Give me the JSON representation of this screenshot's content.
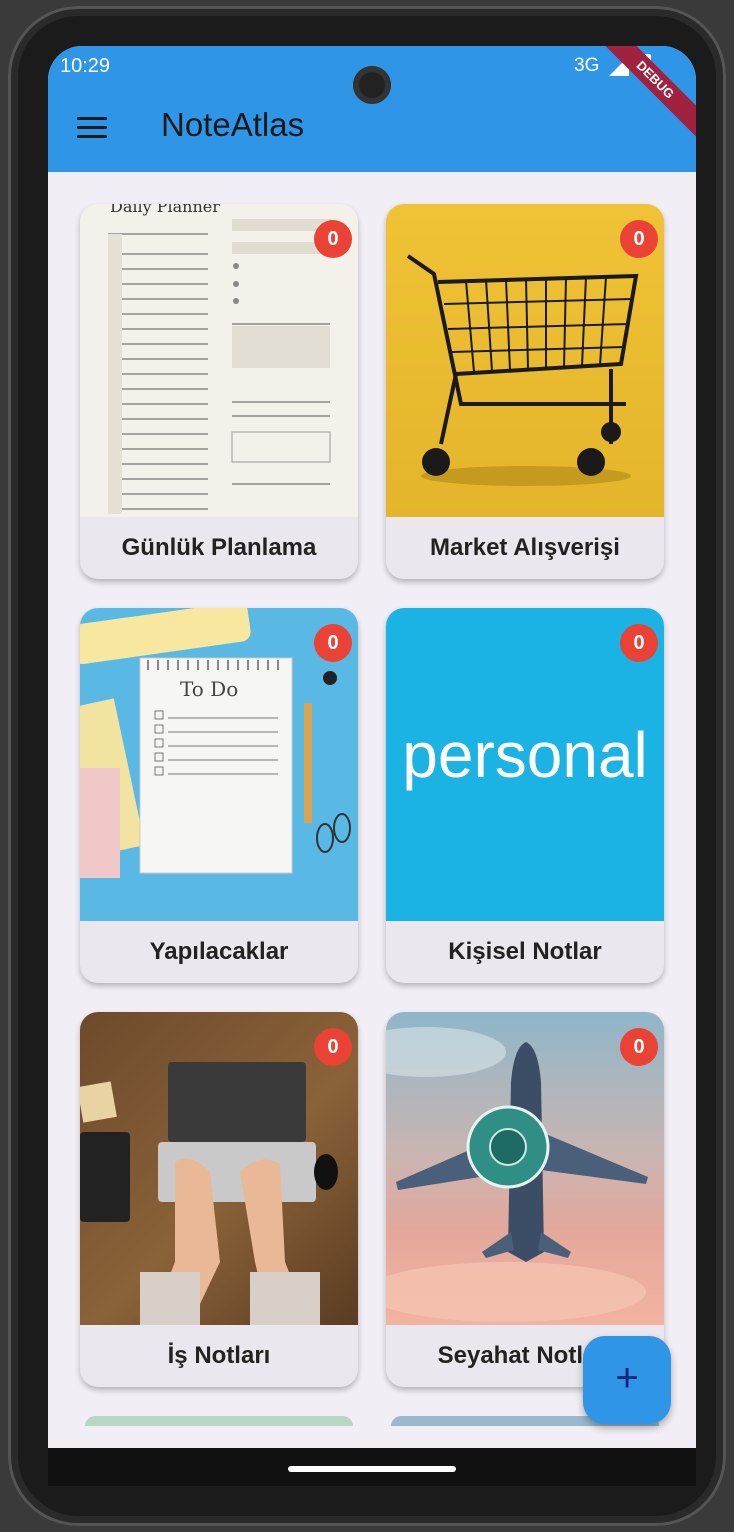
{
  "status_bar": {
    "time": "10:29",
    "network": "3G",
    "debug_banner": "DEBUG"
  },
  "app_bar": {
    "title": "NoteAtlas",
    "menu_icon": "hamburger-menu-icon"
  },
  "categories": [
    {
      "label": "Günlük Planlama",
      "count": "0",
      "image": "daily-planner-image",
      "image_heading": "Daily Planner"
    },
    {
      "label": "Market Alışverişi",
      "count": "0",
      "image": "shopping-cart-image"
    },
    {
      "label": "Yapılacaklar",
      "count": "0",
      "image": "todo-notepad-image",
      "image_heading": "To Do"
    },
    {
      "label": "Kişisel Notlar",
      "count": "0",
      "image": "personal-image",
      "image_text": "personal"
    },
    {
      "label": "İş Notları",
      "count": "0",
      "image": "laptop-typing-image"
    },
    {
      "label": "Seyahat Notları",
      "count": "0",
      "image": "airplane-image"
    }
  ],
  "fab": {
    "label": "+",
    "icon": "plus-icon"
  },
  "colors": {
    "app_bar": "#2f95e6",
    "background": "#f2eef6",
    "badge": "#ea4234"
  }
}
